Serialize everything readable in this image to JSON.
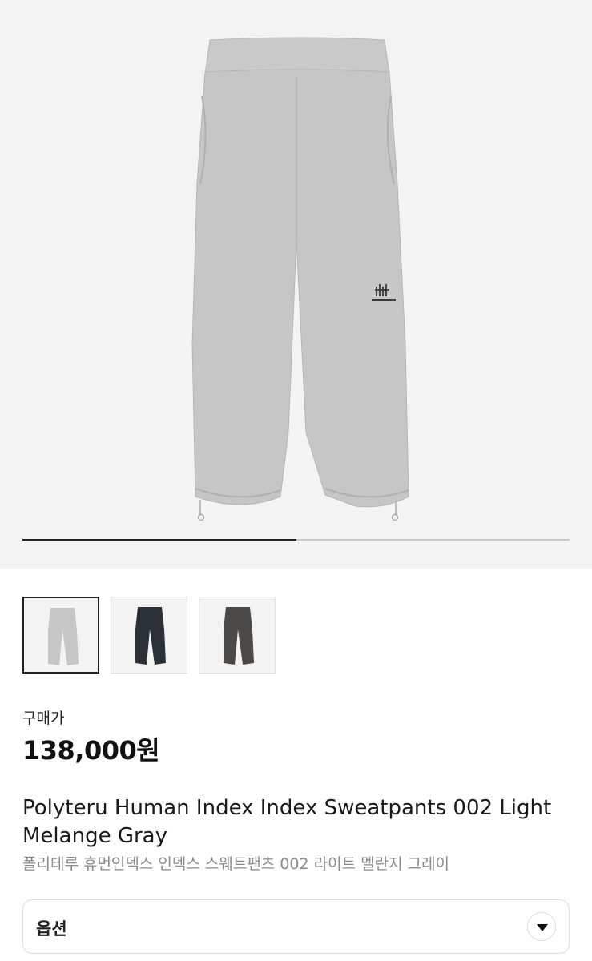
{
  "gallery": {
    "progress_fraction": 0.5,
    "thumbnails": [
      {
        "name": "light-melange-gray",
        "color": "#c6c6c6",
        "selected": true
      },
      {
        "name": "black",
        "color": "#2b2f36",
        "selected": false
      },
      {
        "name": "charcoal",
        "color": "#4b4a48",
        "selected": false
      }
    ]
  },
  "product": {
    "price_label": "구매가",
    "price": "138,000원",
    "title_en": "Polyteru Human Index Index Sweatpants 002 Light Melange Gray",
    "title_ko": "폴리테루 휴먼인덱스 인덱스 스웨트팬츠 002 라이트 멜란지 그레이"
  },
  "option": {
    "label": "옵션",
    "icon": "chevron-down-icon"
  },
  "colors": {
    "hero_bg": "#f3f3f3",
    "pants_gray": "#c6c6c6",
    "text_dark": "#111111",
    "text_muted": "#8a8a8a"
  }
}
